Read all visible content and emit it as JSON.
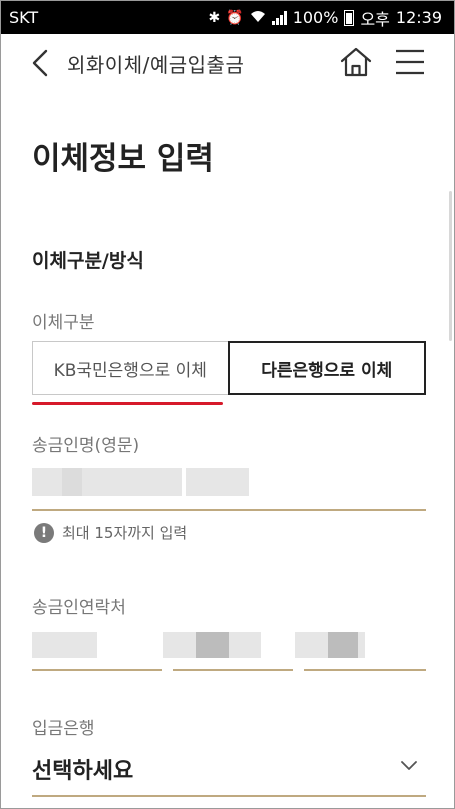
{
  "status_bar": {
    "carrier": "SKT",
    "battery": "100%",
    "ampm": "오후",
    "time": "12:39"
  },
  "header": {
    "title": "외화이체/예금입출금"
  },
  "page": {
    "title": "이체정보 입력",
    "section_title": "이체구분/방식"
  },
  "transfer_type": {
    "label": "이체구분",
    "options": [
      "KB국민은행으로 이체",
      "다른은행으로 이체"
    ],
    "selected": "다른은행으로 이체"
  },
  "sender_name": {
    "label": "송금인명(영문)",
    "hint": "최대 15자까지 입력"
  },
  "sender_contact": {
    "label": "송금인연락처"
  },
  "receiving_bank": {
    "label": "입금은행",
    "value": "선택하세요"
  },
  "icons": {
    "back": "chevron-left-icon",
    "home": "home-icon",
    "menu": "hamburger-menu-icon",
    "info": "exclamation-circle-icon",
    "dropdown": "chevron-down-icon"
  },
  "colors": {
    "accent_underline": "#bfa980",
    "red_mark": "#d6192a",
    "selected_border": "#222222"
  }
}
